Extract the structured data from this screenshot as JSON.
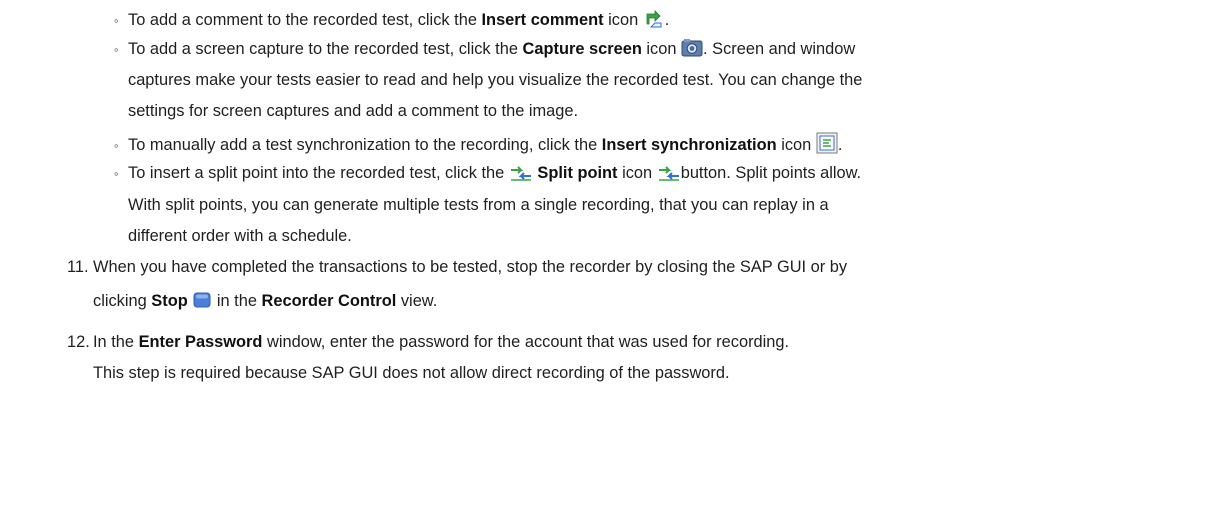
{
  "bullets": [
    {
      "lines": [
        {
          "parts": [
            "To add a comment to the recorded test, click the ",
            "Insert comment",
            " icon ",
            "."
          ]
        }
      ]
    },
    {
      "lines": [
        {
          "parts": [
            "To add a screen capture to the recorded test, click the ",
            "Capture screen",
            " icon ",
            ". Screen and window"
          ]
        },
        {
          "text": "captures make your tests easier to read and help you visualize the recorded test. You can change the"
        },
        {
          "text": "settings for screen captures and add a comment to the image."
        }
      ]
    },
    {
      "lines": [
        {
          "parts": [
            "To manually add a test synchronization to the recording, click the ",
            "Insert synchronization",
            " icon ",
            "."
          ]
        }
      ]
    },
    {
      "lines": [
        {
          "parts": [
            "To insert a split point into the recorded test, click the ",
            "",
            "Split point",
            " icon ",
            "button. Split points allow."
          ]
        },
        {
          "text": "With split points, you can generate multiple tests from a single recording, that you can replay in a"
        },
        {
          "text": "different order with a schedule."
        }
      ]
    }
  ],
  "steps": [
    {
      "number": "11.",
      "line1": "When you have completed the transactions to be tested, stop the recorder by closing the SAP GUI or by",
      "line2_parts": [
        "clicking ",
        "Stop",
        " ",
        " in the ",
        "Recorder Control",
        " view."
      ]
    },
    {
      "number": "12.",
      "line1_parts": [
        "In the ",
        "Enter Password",
        " window, enter the password for the account that was used for recording."
      ],
      "line2": "This step is required because SAP GUI does not allow direct recording of the password."
    }
  ],
  "icons": {
    "insert_comment": "insert-comment-icon",
    "capture_screen": "capture-screen-icon",
    "insert_sync": "insert-synchronization-icon",
    "split_point": "split-point-icon",
    "stop": "stop-icon"
  },
  "colors": {
    "text": "#1f1f1f",
    "icon_green": "#3aa34a",
    "icon_blue": "#2f6fd6",
    "stop_blue": "#4a7fd8"
  }
}
